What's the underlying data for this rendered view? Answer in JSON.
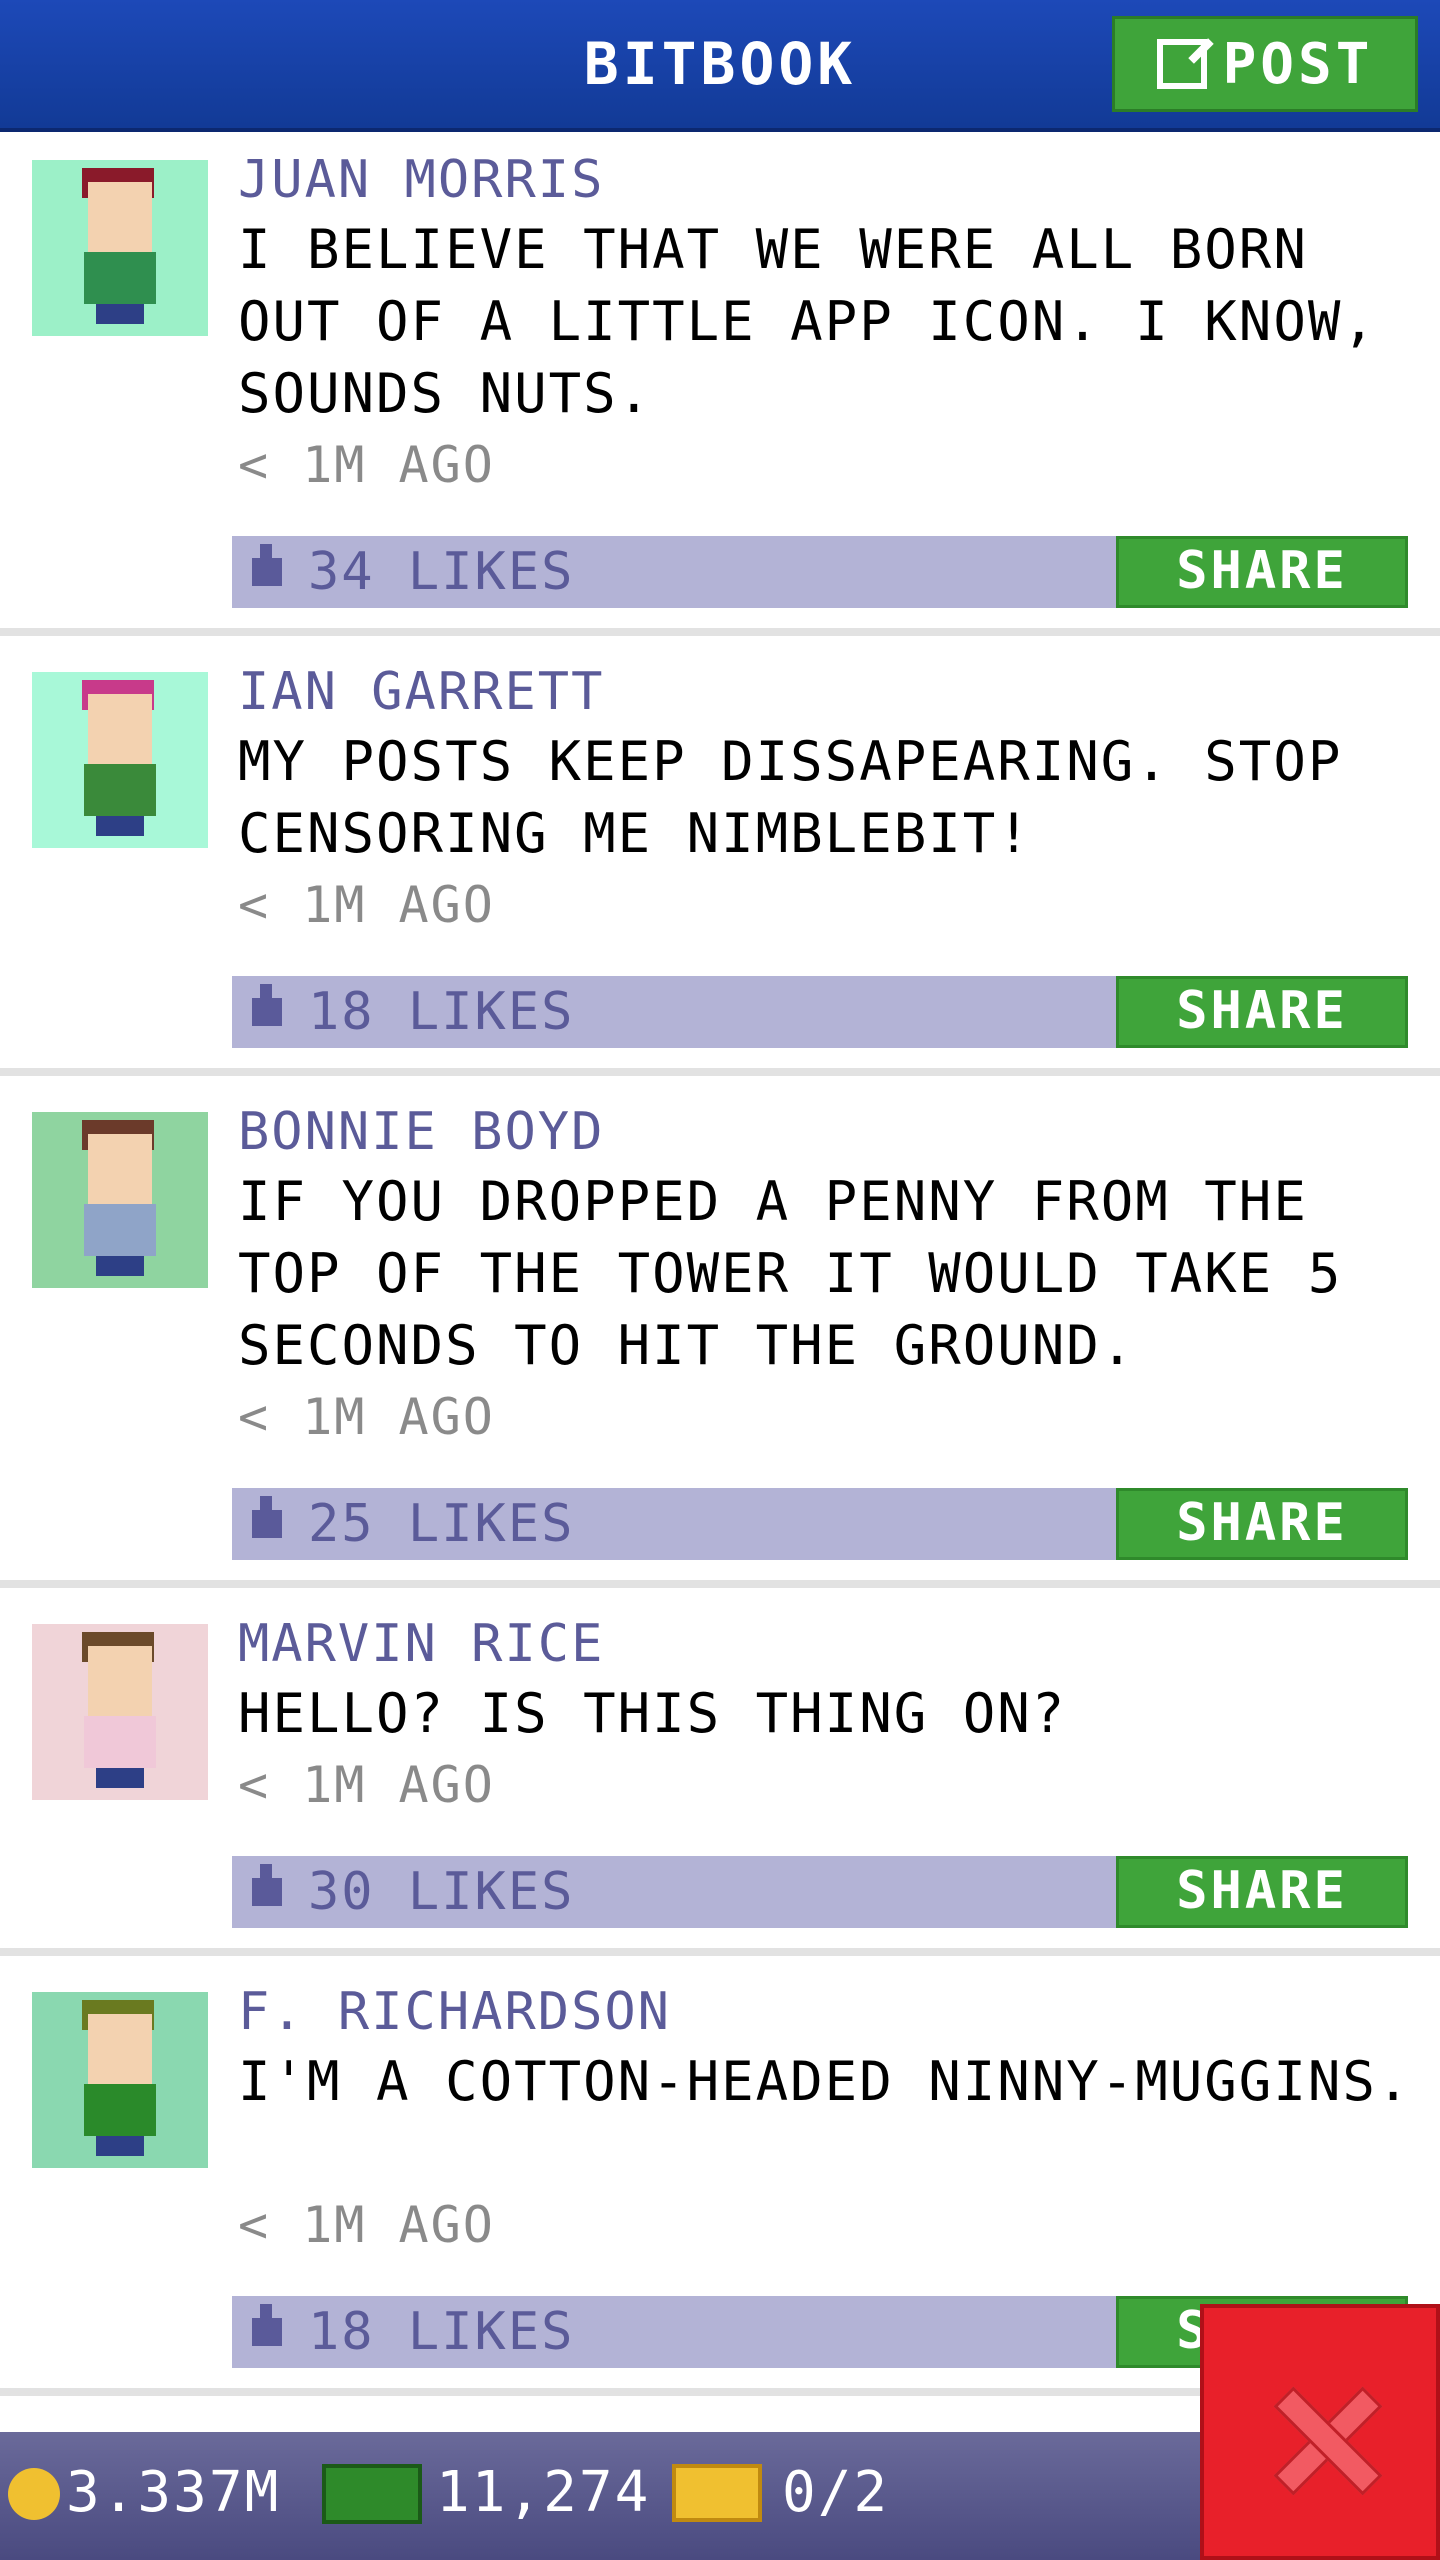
{
  "header": {
    "title": "BITBOOK",
    "post_label": "POST"
  },
  "posts": [
    {
      "name": "JUAN MORRIS",
      "text": "I BELIEVE THAT WE WERE ALL BORN OUT OF A LITTLE APP ICON. I KNOW, SOUNDS NUTS.",
      "time": "< 1M AGO",
      "likes": "34 LIKES",
      "share": "SHARE",
      "avatar_bg": "#9cf0c8",
      "hat": "#8a1a2a",
      "shirt": "#2f8f4f"
    },
    {
      "name": "IAN GARRETT",
      "text": "MY POSTS KEEP DISSAPEARING. STOP CENSORING ME NIMBLEBIT!",
      "time": "< 1M AGO",
      "likes": "18 LIKES",
      "share": "SHARE",
      "avatar_bg": "#a8f8d8",
      "hat": "#c83a8a",
      "shirt": "#3a8a3a"
    },
    {
      "name": "BONNIE BOYD",
      "text": "IF YOU DROPPED A PENNY FROM THE TOP OF THE TOWER IT WOULD TAKE 5 SECONDS TO HIT THE GROUND.",
      "time": "< 1M AGO",
      "likes": "25 LIKES",
      "share": "SHARE",
      "avatar_bg": "#8fd4a0",
      "hat": "#6b3a2a",
      "shirt": "#8fa4c8"
    },
    {
      "name": "MARVIN RICE",
      "text": "HELLO? IS THIS THING ON?",
      "time": "< 1M AGO",
      "likes": "30 LIKES",
      "share": "SHARE",
      "avatar_bg": "#f0d4d8",
      "hat": "#6b4a2a",
      "shirt": "#f0c8d8"
    },
    {
      "name": "F. RICHARDSON",
      "text": "I'M A COTTON-HEADED NINNY-MUGGINS.",
      "time": "< 1M AGO",
      "likes": "18 LIKES",
      "share": "SHARE",
      "avatar_bg": "#8ad8b0",
      "hat": "#6a7a20",
      "shirt": "#2a8a2a"
    }
  ],
  "footer": {
    "coins": "3.337M",
    "bux": "11,274",
    "tickets": "0/2"
  }
}
